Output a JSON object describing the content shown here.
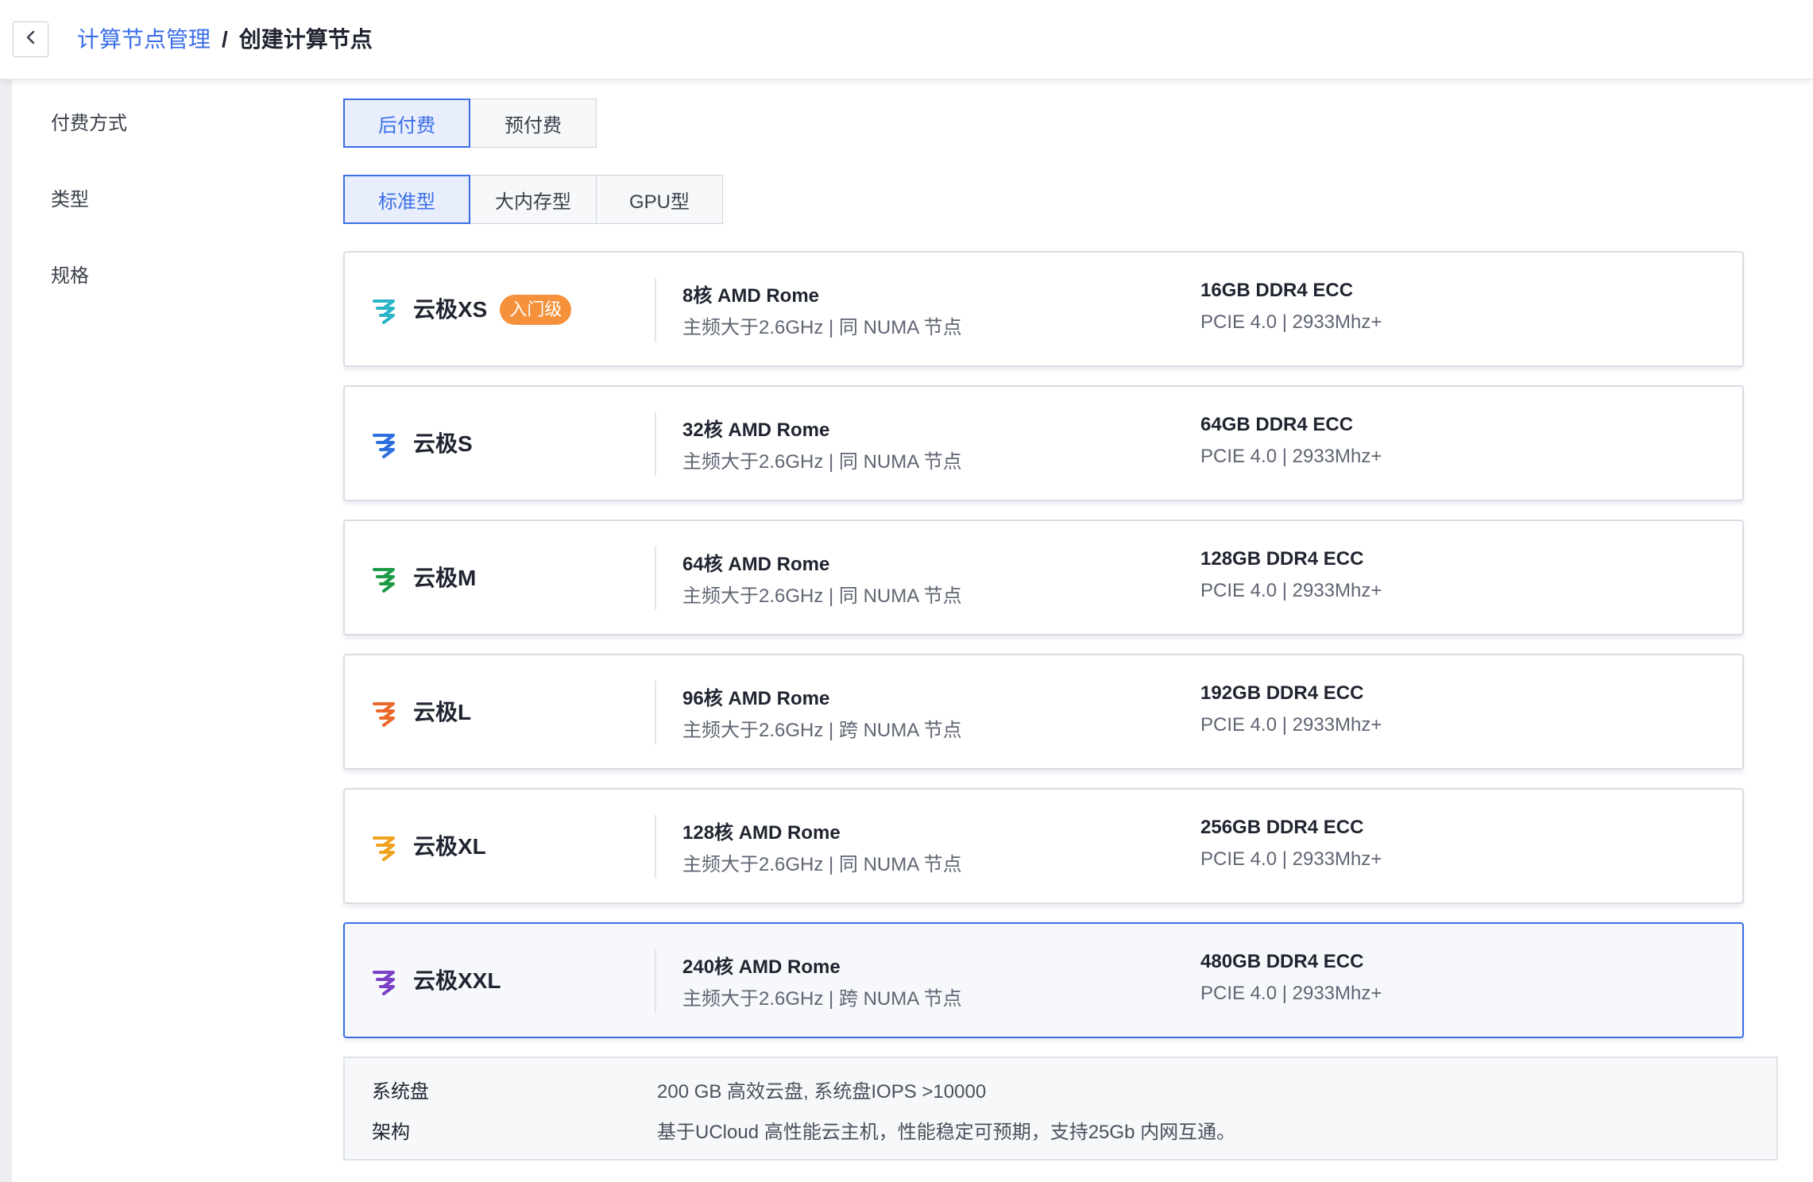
{
  "header": {
    "breadcrumb_parent": "计算节点管理",
    "breadcrumb_sep": "/",
    "breadcrumb_current": "创建计算节点",
    "back_icon": "chevron-left-icon"
  },
  "form": {
    "billing": {
      "label": "付费方式",
      "options": [
        "后付费",
        "预付费"
      ],
      "selected": "后付费"
    },
    "type": {
      "label": "类型",
      "options": [
        "标准型",
        "大内存型",
        "GPU型"
      ],
      "selected": "标准型"
    },
    "spec": {
      "label": "规格",
      "selected": "云极XXL",
      "items": [
        {
          "name": "云极XS",
          "badge": "入门级",
          "color": "#2bb3c8",
          "cpu": "8核 AMD Rome",
          "cpu_detail": "主频大于2.6GHz | 同 NUMA 节点",
          "mem": "16GB DDR4 ECC",
          "mem_detail": "PCIE 4.0 | 2933Mhz+"
        },
        {
          "name": "云极S",
          "color": "#2d6fdc",
          "cpu": "32核 AMD Rome",
          "cpu_detail": "主频大于2.6GHz | 同 NUMA 节点",
          "mem": "64GB DDR4 ECC",
          "mem_detail": "PCIE 4.0 | 2933Mhz+"
        },
        {
          "name": "云极M",
          "color": "#1f9a48",
          "cpu": "64核 AMD Rome",
          "cpu_detail": "主频大于2.6GHz | 同 NUMA 节点",
          "mem": "128GB DDR4 ECC",
          "mem_detail": "PCIE 4.0 | 2933Mhz+"
        },
        {
          "name": "云极L",
          "color": "#e8692a",
          "cpu": "96核 AMD Rome",
          "cpu_detail": "主频大于2.6GHz | 跨 NUMA 节点",
          "mem": "192GB DDR4 ECC",
          "mem_detail": "PCIE 4.0 | 2933Mhz+"
        },
        {
          "name": "云极XL",
          "color": "#efa21e",
          "cpu": "128核 AMD Rome",
          "cpu_detail": "主频大于2.6GHz | 同 NUMA 节点",
          "mem": "256GB DDR4 ECC",
          "mem_detail": "PCIE 4.0 | 2933Mhz+"
        },
        {
          "name": "云极XXL",
          "color": "#7b3fc4",
          "cpu": "240核 AMD Rome",
          "cpu_detail": "主频大于2.6GHz | 跨 NUMA 节点",
          "mem": "480GB DDR4 ECC",
          "mem_detail": "PCIE 4.0 | 2933Mhz+"
        }
      ]
    },
    "info": {
      "system_disk_label": "系统盘",
      "system_disk_value": "200 GB 高效云盘, 系统盘IOPS >10000",
      "arch_label": "架构",
      "arch_value": "基于UCloud 高性能云主机，性能稳定可预期，支持25Gb 内网互通。"
    }
  }
}
